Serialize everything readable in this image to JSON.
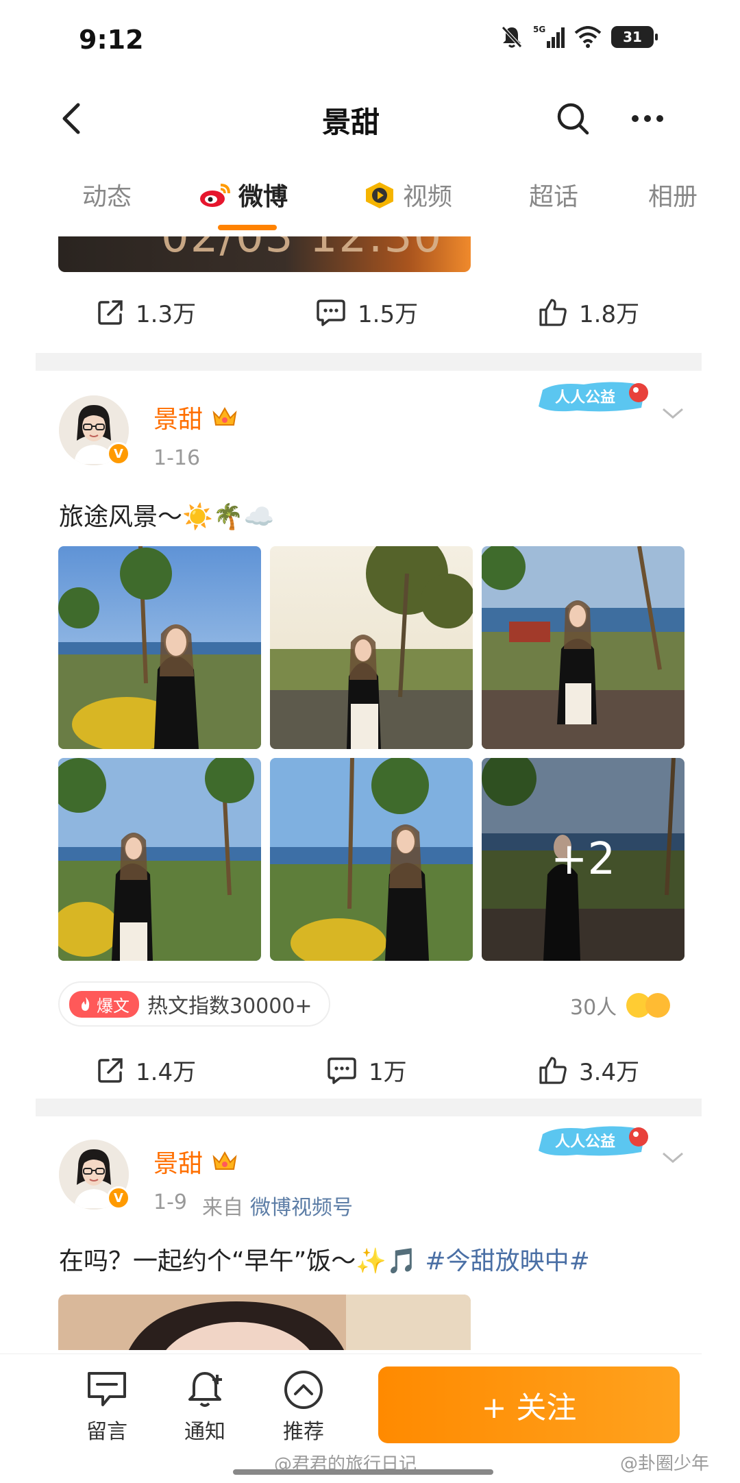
{
  "status_bar": {
    "time": "9:12",
    "network": "5G",
    "battery": "31"
  },
  "header": {
    "title": "景甜"
  },
  "tabs": [
    {
      "label": "动态",
      "active": false
    },
    {
      "label": "微博",
      "active": true
    },
    {
      "label": "视频",
      "active": false
    },
    {
      "label": "超话",
      "active": false
    },
    {
      "label": "相册",
      "active": false
    }
  ],
  "prev_post": {
    "image_text": "02/03 12:30",
    "repost": "1.3万",
    "comment": "1.5万",
    "like": "1.8万"
  },
  "post1": {
    "username": "景甜",
    "date": "1-16",
    "text": "旅途风景～☀️🌴☁️",
    "more_count": "+2",
    "hot_tag": "爆文",
    "hot_index": "热文指数30000+",
    "react_count": "30人",
    "repost": "1.4万",
    "comment": "1万",
    "like": "3.4万"
  },
  "post2": {
    "username": "景甜",
    "date": "1-9",
    "source_prefix": "来自",
    "source": "微博视频号",
    "text_main": "在吗？一起约个“早午”饭～✨🎵",
    "hashtag": "#今甜放映中#"
  },
  "charity_badge": "人人公益",
  "bottom_bar": {
    "message": "留言",
    "notify": "通知",
    "recommend": "推荐",
    "follow": "+ 关注"
  },
  "watermarks": {
    "left": "@君君的旅行日记",
    "right": "@卦圈少年"
  },
  "colors": {
    "accent": "#ff8200",
    "username": "#ff6f00",
    "hashtag": "#4a6fa5"
  }
}
